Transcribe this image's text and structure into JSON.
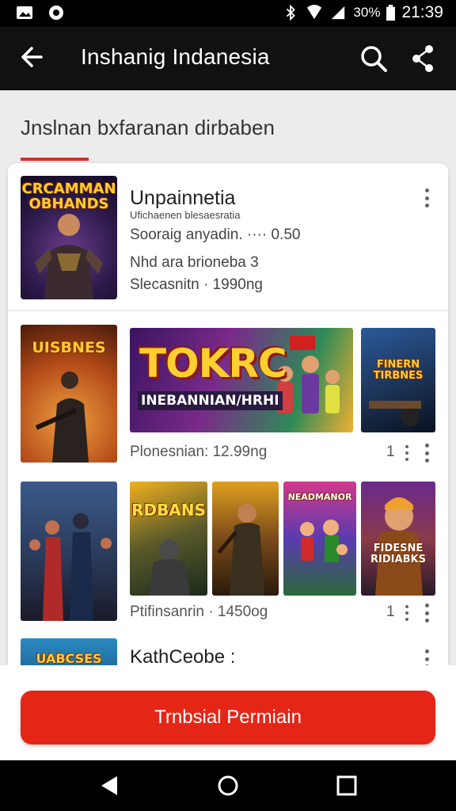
{
  "status_bar": {
    "battery_text": "30%",
    "time": "21:39"
  },
  "app_bar": {
    "title": "Inshanig Indanesia"
  },
  "section": {
    "title": "Jnslnan bxfaranan dirbaben"
  },
  "featured": {
    "thumb_label": "CRCAMMAN OBHANDS",
    "title": "Unpainnetia",
    "subtitle": "Ufichaenen blesaesratia",
    "line1": "Sooraig anyadin. ···· 0.50",
    "line2": "Nhd ara brioneba 3",
    "line3": "Slecasnitn · 1990ng"
  },
  "row2": {
    "thumb_labels": [
      "UISBNES",
      "TOKRC",
      "FINERN TIRBNES"
    ],
    "banner_sub": "INEBANNIAN/HRHI",
    "caption": "Plonesnian: 12.99ng",
    "count": "1"
  },
  "row3": {
    "thumb_labels": [
      "",
      "RDBANS",
      "",
      "NEADMANOR",
      "FIDESNE RIDIABKS"
    ],
    "caption": "Ptifinsanrin · 1450og",
    "count": "1"
  },
  "row4": {
    "thumb_label": "UABCSES",
    "title": "KathCeobe :"
  },
  "cta": {
    "label": "Trnbsial Permiain"
  },
  "colors": {
    "accent": "#e52617",
    "appbar": "#111111",
    "underline": "#d32f2f"
  }
}
